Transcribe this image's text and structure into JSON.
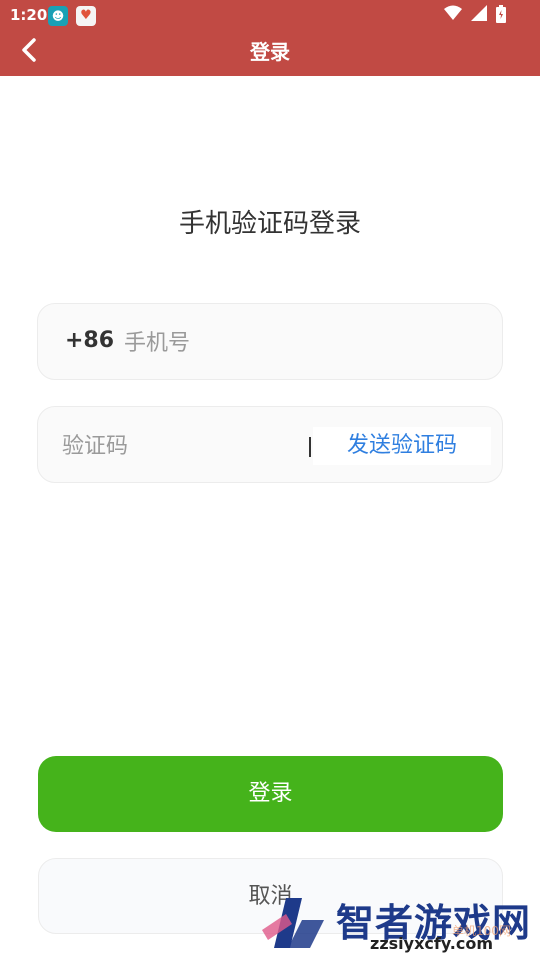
{
  "status_bar": {
    "time": "1:20"
  },
  "header": {
    "title": "登录"
  },
  "page_title": "手机验证码登录",
  "phone_field": {
    "prefix": "+86",
    "placeholder": "手机号"
  },
  "code_field": {
    "placeholder": "验证码",
    "divider": "|",
    "send_label": "发送验证码"
  },
  "buttons": {
    "login": "登录",
    "cancel": "取消"
  },
  "watermark": {
    "title": "智者游戏网",
    "site": "zzsiyxcfy.com",
    "tag": "单机100网"
  },
  "colors": {
    "header": "#c14a44",
    "login": "#45b31b",
    "link": "#2f7fe0"
  }
}
